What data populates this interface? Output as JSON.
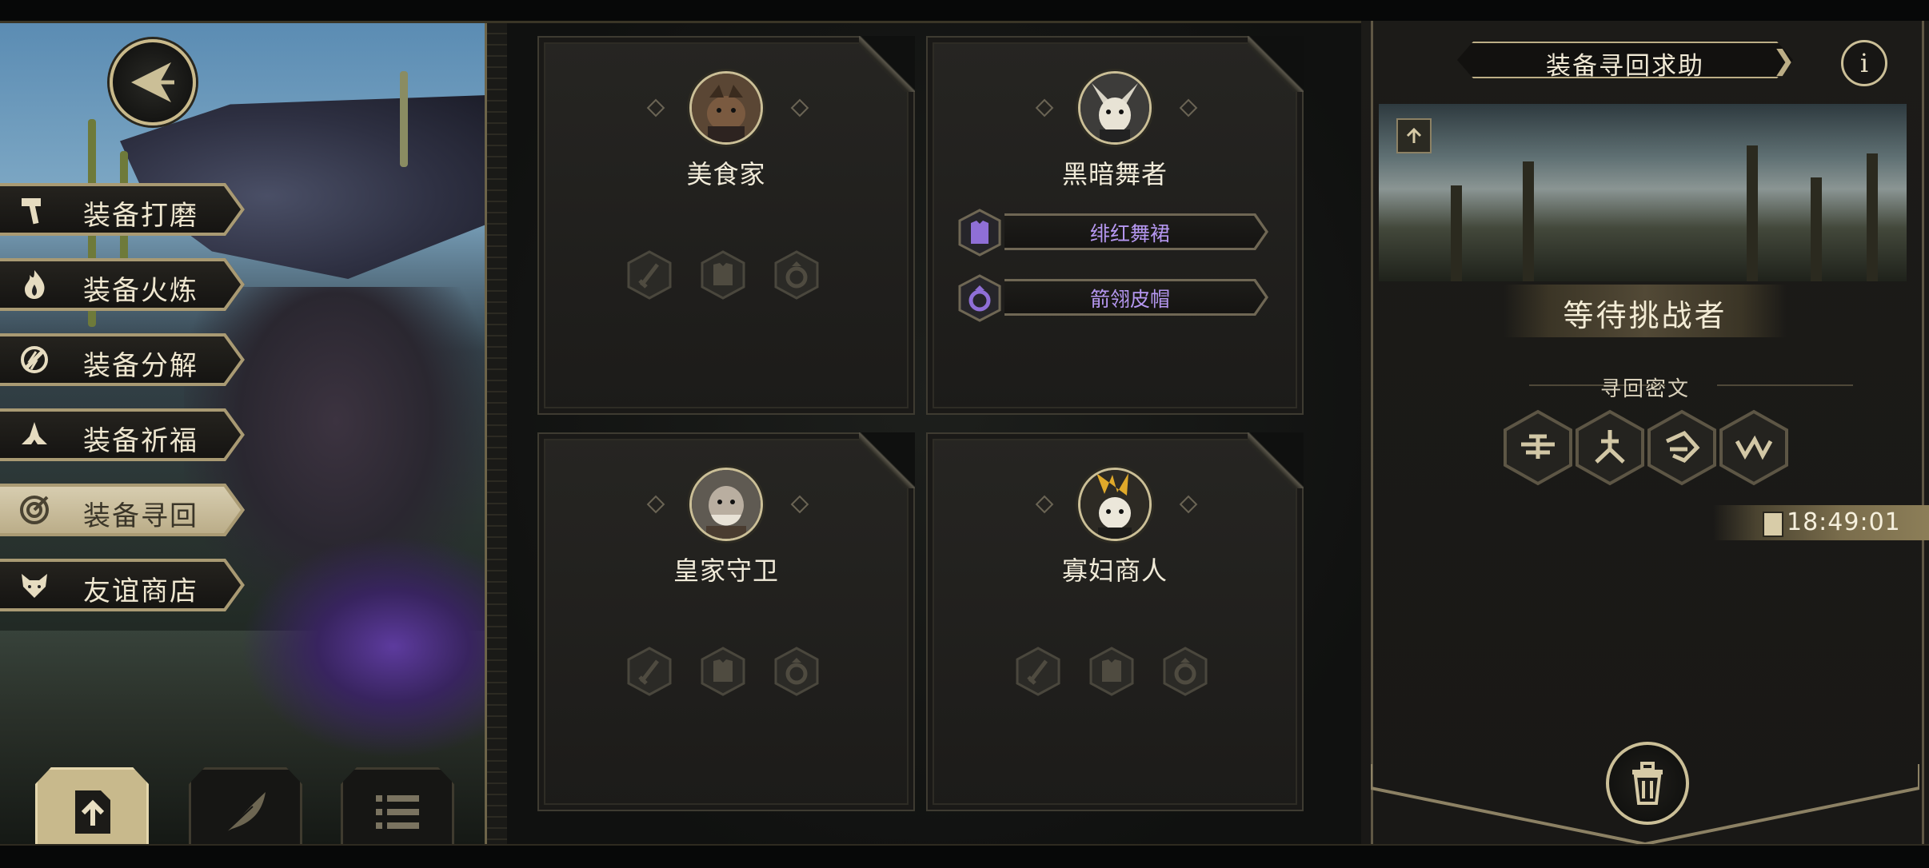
{
  "menu": {
    "items": [
      {
        "label": "装备打磨",
        "icon": "hammer-icon"
      },
      {
        "label": "装备火炼",
        "icon": "flame-icon"
      },
      {
        "label": "装备分解",
        "icon": "decompose-icon"
      },
      {
        "label": "装备祈福",
        "icon": "praying-hands-icon"
      },
      {
        "label": "装备寻回",
        "icon": "target-icon",
        "active": true
      },
      {
        "label": "友谊商店",
        "icon": "fox-icon"
      }
    ]
  },
  "bottom_buttons": [
    {
      "icon": "upload-document-icon",
      "active": true
    },
    {
      "icon": "feather-icon",
      "active": false
    },
    {
      "icon": "list-icon",
      "active": false
    }
  ],
  "characters": [
    {
      "name": "美食家",
      "equipment": [],
      "empty_slots": [
        "sword-icon",
        "armor-icon",
        "ring-icon"
      ]
    },
    {
      "name": "黑暗舞者",
      "equipment": [
        {
          "name": "绯红舞裙",
          "icon": "armor-icon"
        },
        {
          "name": "箭翎皮帽",
          "icon": "ring-icon"
        }
      ],
      "empty_slots": []
    },
    {
      "name": "皇家守卫",
      "equipment": [],
      "empty_slots": [
        "sword-icon",
        "armor-icon",
        "ring-icon"
      ]
    },
    {
      "name": "寡妇商人",
      "equipment": [],
      "empty_slots": [
        "sword-icon",
        "armor-icon",
        "ring-icon"
      ]
    }
  ],
  "panel": {
    "title": "装备寻回求助",
    "info_label": "i",
    "status": "等待挑战者",
    "runes_title": "寻回密文",
    "runes": [
      "rune-1-icon",
      "rune-2-icon",
      "rune-3-icon",
      "rune-4-icon"
    ],
    "timer": "18:49:01"
  },
  "colors": {
    "accent_gold": "#cbbf97",
    "equipment_text_purple": "#b597f0",
    "active_menu": "#c8b98c"
  }
}
